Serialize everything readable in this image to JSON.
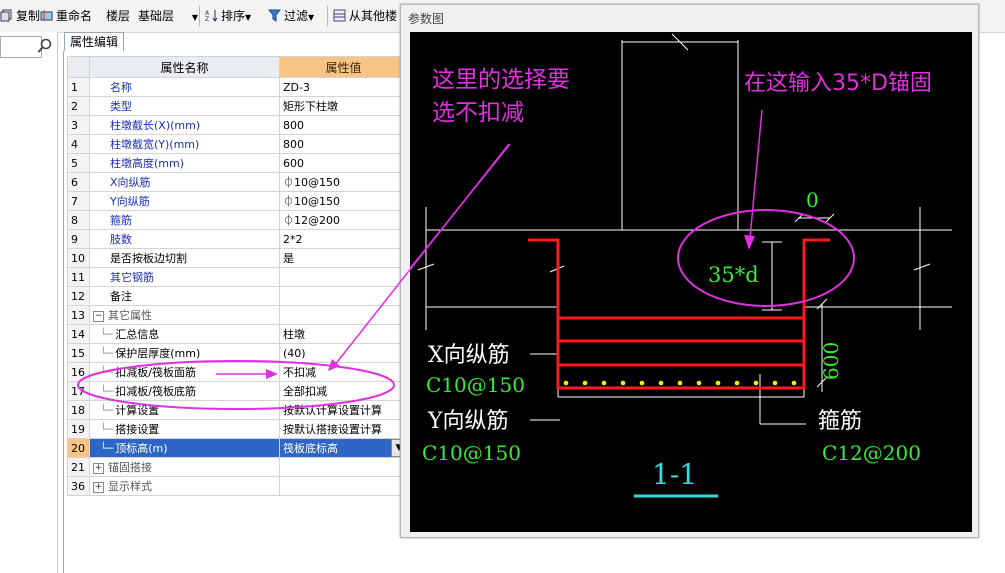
{
  "toolbar": {
    "copy_label": "复制",
    "rename_label": "重命名",
    "floor_label": "楼层",
    "floor_value": "基础层",
    "sort_label": "排序",
    "filter_label": "过滤",
    "copy_from_other_label": "从其他楼"
  },
  "properties": {
    "tab_label": "属性编辑",
    "col_name": "属性名称",
    "col_value": "属性值",
    "rows": [
      {
        "num": "1",
        "name": "名称",
        "value": "ZD-3"
      },
      {
        "num": "2",
        "name": "类型",
        "value": "矩形下柱墩"
      },
      {
        "num": "3",
        "name": "柱墩截长(X)(mm)",
        "value": "800"
      },
      {
        "num": "4",
        "name": "柱墩截宽(Y)(mm)",
        "value": "800"
      },
      {
        "num": "5",
        "name": "柱墩高度(mm)",
        "value": "600"
      },
      {
        "num": "6",
        "name": "X向纵筋",
        "value": "⏀10@150"
      },
      {
        "num": "7",
        "name": "Y向纵筋",
        "value": "⏀10@150"
      },
      {
        "num": "8",
        "name": "箍筋",
        "value": "⏀12@200"
      },
      {
        "num": "9",
        "name": "肢数",
        "value": "2*2"
      },
      {
        "num": "10",
        "name": "是否按板边切割",
        "value": "是"
      },
      {
        "num": "11",
        "name": "其它钢筋",
        "value": ""
      },
      {
        "num": "12",
        "name": "备注",
        "value": ""
      },
      {
        "num": "13",
        "name": "其它属性",
        "value": ""
      },
      {
        "num": "14",
        "name": "汇总信息",
        "value": "柱墩"
      },
      {
        "num": "15",
        "name": "保护层厚度(mm)",
        "value": "(40)"
      },
      {
        "num": "16",
        "name": "扣减板/筏板面筋",
        "value": "不扣减"
      },
      {
        "num": "17",
        "name": "扣减板/筏板底筋",
        "value": "全部扣减"
      },
      {
        "num": "18",
        "name": "计算设置",
        "value": "按默认计算设置计算"
      },
      {
        "num": "19",
        "name": "搭接设置",
        "value": "按默认搭接设置计算"
      },
      {
        "num": "20",
        "name": "顶标高(m)",
        "value": "筏板底标高"
      },
      {
        "num": "21",
        "name": "锚固搭接",
        "value": ""
      },
      {
        "num": "36",
        "name": "显示样式",
        "value": ""
      }
    ]
  },
  "diagram": {
    "panel_title": "参数图",
    "annotation_left_line1": "这里的选择要",
    "annotation_left_line2": "选不扣减",
    "annotation_right": "在这输入35*D锚固",
    "dim_top": "0",
    "dim_anchor": "35*d",
    "dim_height": "600",
    "label_x": "X向纵筋",
    "label_x_spec": "C10@150",
    "label_y": "Y向纵筋",
    "label_y_spec": "C10@150",
    "label_stirrup": "箍筋",
    "label_stirrup_spec": "C12@200",
    "section_label": "1-1",
    "colors": {
      "annotation": "#e030e0",
      "rebar": "#ff1a1a",
      "dim_green": "#33ee33",
      "section": "#33dddd",
      "dots": "#ffee00",
      "lines": "#ffffff"
    }
  }
}
